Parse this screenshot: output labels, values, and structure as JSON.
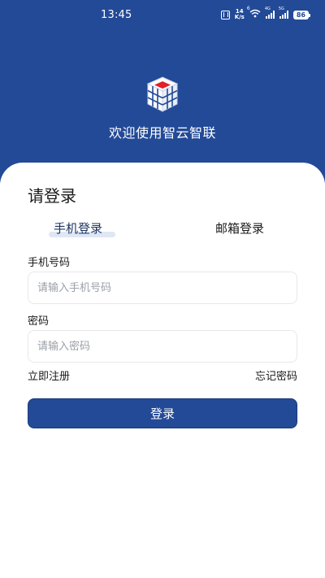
{
  "status_bar": {
    "time": "13:45",
    "net_speed_value": "14",
    "net_speed_unit": "K/s",
    "wifi_label": "6",
    "signal1_label": "4G",
    "signal2_label": "5G",
    "battery": "86"
  },
  "header": {
    "welcome": "欢迎使用智云智联"
  },
  "login": {
    "title": "请登录",
    "tabs": [
      {
        "label": "手机登录",
        "active": true
      },
      {
        "label": "邮箱登录",
        "active": false
      }
    ],
    "phone_label": "手机号码",
    "phone_placeholder": "请输入手机号码",
    "password_label": "密码",
    "password_placeholder": "请输入密码",
    "register_link": "立即注册",
    "forgot_link": "忘记密码",
    "submit_label": "登录"
  },
  "colors": {
    "brand": "#234a97",
    "tab_highlight": "#dfe7f5",
    "logo_accent": "#e0202a"
  }
}
